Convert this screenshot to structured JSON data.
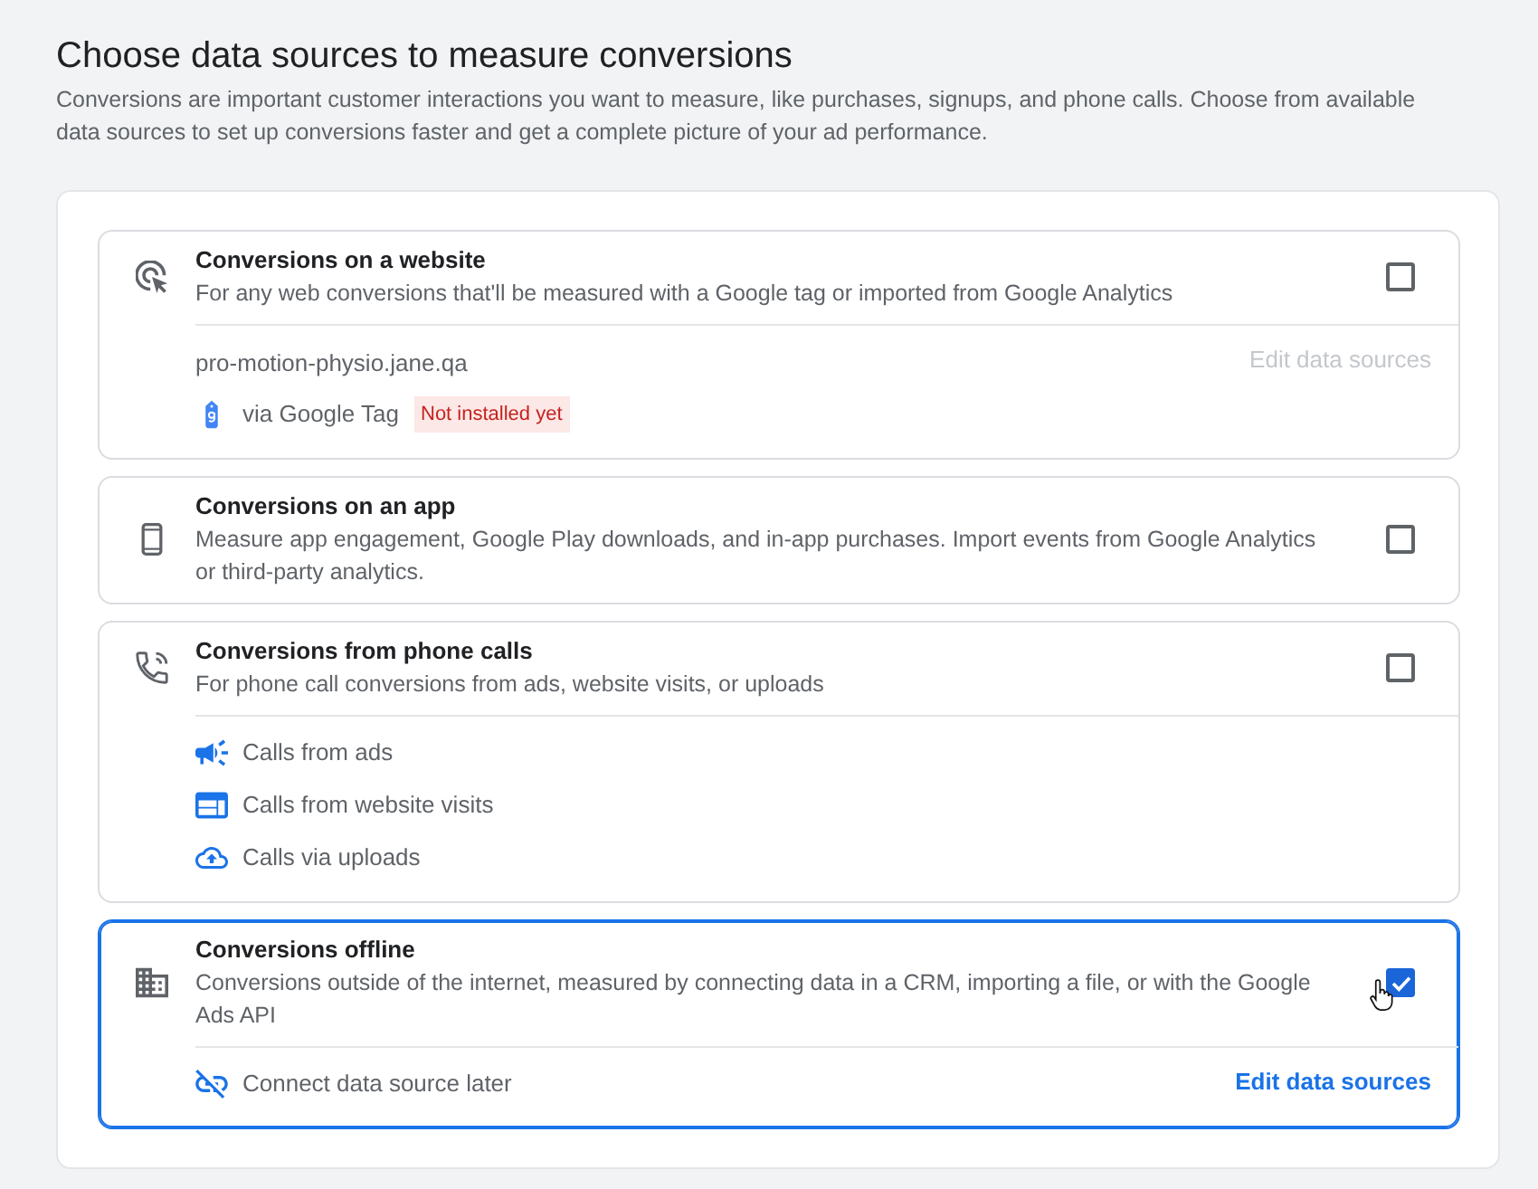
{
  "header": {
    "title": "Choose data sources to measure conversions",
    "description": "Conversions are important customer interactions you want to measure, like purchases, signups, and phone calls. Choose from available data sources to set up conversions faster and get a complete picture of your ad performance."
  },
  "sources": [
    {
      "kind": "website",
      "title": "Conversions on a website",
      "description": "For any web conversions that'll be measured with a Google tag or imported from Google Analytics",
      "checked": false,
      "hovered": false,
      "site": "pro-motion-physio.jane.qa",
      "tag": {
        "label": "via Google Tag",
        "status": "Not installed yet"
      },
      "edit_link": {
        "label": "Edit data sources",
        "disabled": true
      }
    },
    {
      "kind": "app",
      "title": "Conversions on an app",
      "description": "Measure app engagement, Google Play downloads, and in-app purchases. Import events from Google Analytics or third-party analytics.",
      "checked": false,
      "hovered": false
    },
    {
      "kind": "phone",
      "title": "Conversions from phone calls",
      "description": "For phone call conversions from ads, website visits, or uploads",
      "checked": false,
      "hovered": false,
      "options": [
        {
          "kind": "ads",
          "label": "Calls from ads"
        },
        {
          "kind": "website",
          "label": "Calls from website visits"
        },
        {
          "kind": "upload",
          "label": "Calls via uploads"
        }
      ]
    },
    {
      "kind": "offline",
      "title": "Conversions offline",
      "description": "Conversions outside of the internet, measured by connecting data in a CRM, importing a file, or with the Google Ads API",
      "checked": true,
      "hovered": true,
      "options": [
        {
          "kind": "unlinked",
          "label": "Connect data source later"
        }
      ],
      "edit_link": {
        "label": "Edit data sources",
        "disabled": false
      }
    }
  ]
}
